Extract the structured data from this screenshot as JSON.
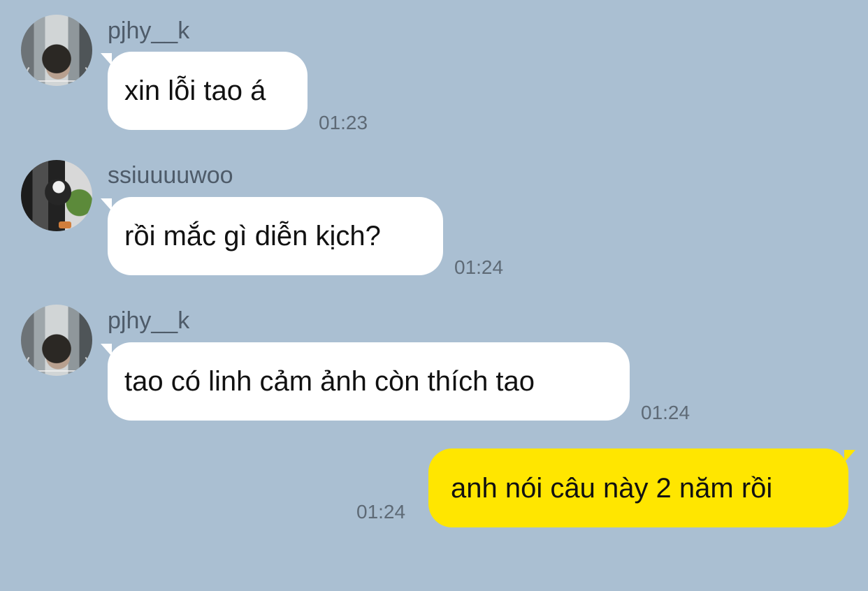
{
  "messages": [
    {
      "sender": "pjhy__k",
      "avatar_icon": "profile-photo-icon",
      "text": "xin lỗi tao á",
      "time": "01:23"
    },
    {
      "sender": "ssiuuuuwoo",
      "avatar_icon": "profile-photo-icon",
      "text": "rồi mắc gì diễn kịch?",
      "time": "01:24"
    },
    {
      "sender": "pjhy__k",
      "avatar_icon": "profile-photo-icon",
      "text": "tao có linh cảm ảnh còn thích tao",
      "time": "01:24"
    },
    {
      "text": "anh nói câu này 2 năm rồi",
      "time": "01:24"
    }
  ],
  "colors": {
    "background": "#aabfd2",
    "incoming_bubble": "#ffffff",
    "outgoing_bubble": "#ffe600",
    "timestamp": "#5e6a76",
    "sender": "#4e5b69"
  }
}
